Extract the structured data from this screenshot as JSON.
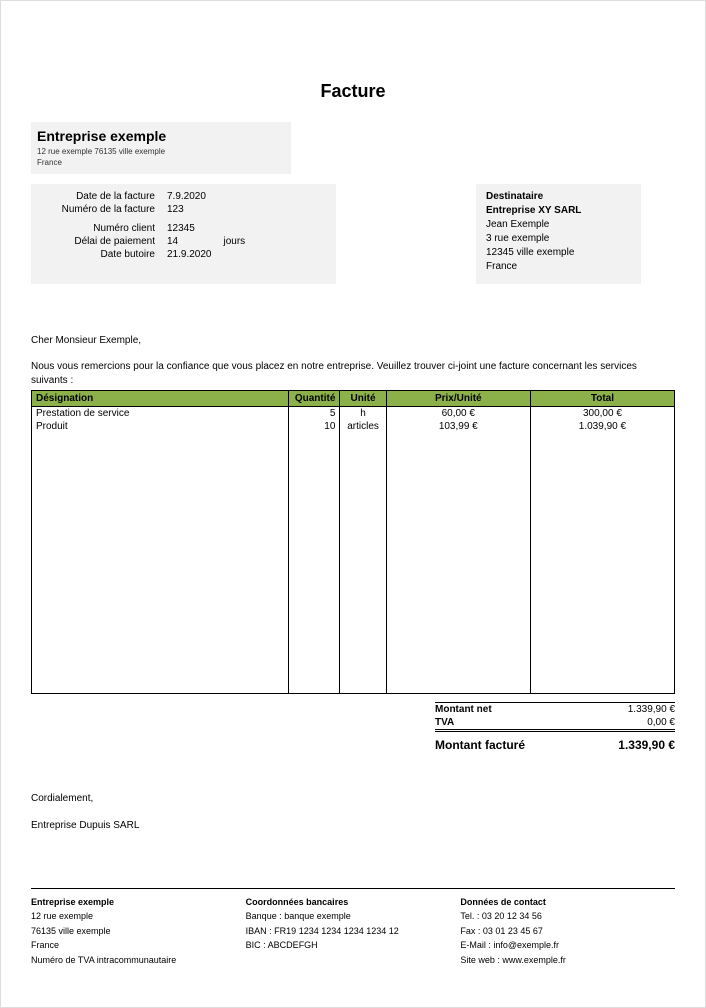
{
  "title": "Facture",
  "company": {
    "name": "Entreprise exemple",
    "addr1": "12 rue exemple 76135 ville exemple",
    "addr2": "France"
  },
  "meta": {
    "date_label": "Date de la facture",
    "date": "7.9.2020",
    "number_label": "Numéro de la facture",
    "number": "123",
    "client_label": "Numéro client",
    "client": "12345",
    "payterm_label": "Délai de paiement",
    "payterm": "14",
    "payterm_unit": "jours",
    "due_label": "Date butoire",
    "due": "21.9.2020"
  },
  "recipient": {
    "heading": "Destinataire",
    "company": "Entreprise XY SARL",
    "name": "Jean Exemple",
    "street": "3 rue exemple",
    "city": "12345 ville exemple",
    "country": "France"
  },
  "salutation": "Cher Monsieur Exemple,",
  "intro": "Nous vous remercions pour la confiance que vous placez en notre entreprise. Veuillez trouver ci-joint une facture concernant les services suivants :",
  "columns": {
    "desig": "Désignation",
    "qty": "Quantité",
    "unit": "Unité",
    "pu": "Prix/Unité",
    "total": "Total"
  },
  "items": [
    {
      "desig": "Prestation de service",
      "qty": "5",
      "unit": "h",
      "pu": "60,00 €",
      "total": "300,00 €"
    },
    {
      "desig": "Produit",
      "qty": "10",
      "unit": "articles",
      "pu": "103,99 €",
      "total": "1.039,90 €"
    }
  ],
  "totals": {
    "net_label": "Montant net",
    "net": "1.339,90 €",
    "tva_label": "TVA",
    "tva": "0,00 €",
    "grand_label": "Montant facturé",
    "grand": "1.339,90 €"
  },
  "closing": "Cordialement,",
  "signature": "Entreprise Dupuis SARL",
  "footer": {
    "col1": {
      "heading": "Entreprise exemple",
      "l1": "12 rue exemple",
      "l2": "76135 ville exemple",
      "l3": "France",
      "l4": "Numéro de TVA intracommunautaire"
    },
    "col2": {
      "heading": "Coordonnées bancaires",
      "l1": "Banque : banque exemple",
      "l2": "IBAN : FR19 1234 1234 1234 1234 12",
      "l3": "BIC : ABCDEFGH"
    },
    "col3": {
      "heading": "Données de contact",
      "l1": "Tel. : 03 20 12 34 56",
      "l2": "Fax : 03 01 23 45 67",
      "l3": "E-Mail : info@exemple.fr",
      "l4": "Site web : www.exemple.fr"
    }
  }
}
